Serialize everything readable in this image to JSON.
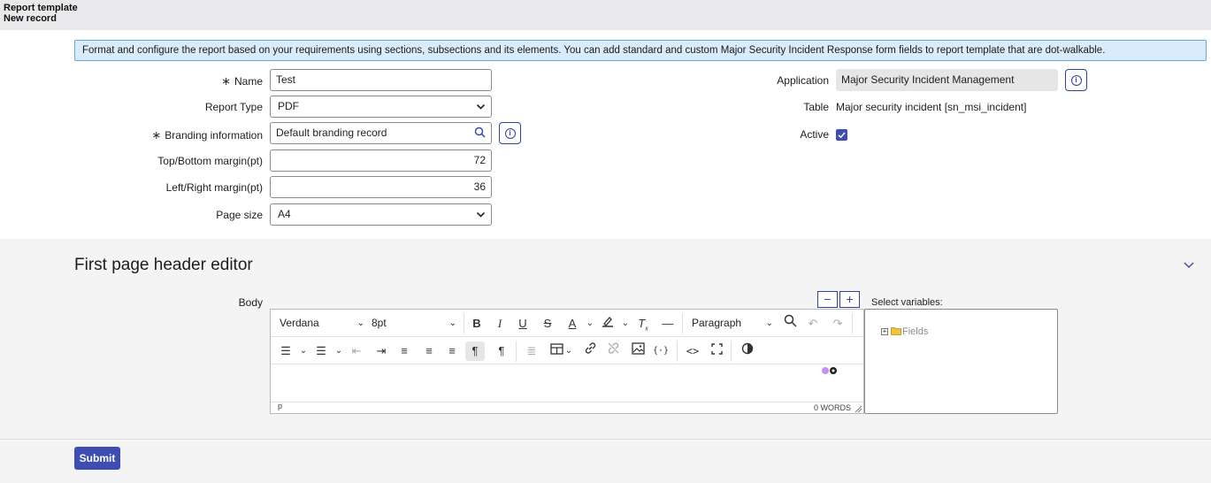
{
  "header": {
    "title": "Report template",
    "subtitle": "New record"
  },
  "banner": {
    "text": "Format and configure the report based on your requirements using sections, subsections and its elements. You can add standard and custom Major Security Incident Response form fields to report template that are dot-walkable."
  },
  "form": {
    "name_label": "Name",
    "name_value": "Test",
    "report_type_label": "Report Type",
    "report_type_value": "PDF",
    "branding_label": "Branding information",
    "branding_value": "Default branding record",
    "top_bottom_label": "Top/Bottom margin(pt)",
    "top_bottom_value": "72",
    "left_right_label": "Left/Right margin(pt)",
    "left_right_value": "36",
    "page_size_label": "Page size",
    "page_size_value": "A4",
    "application_label": "Application",
    "application_value": "Major Security Incident Management",
    "table_label": "Table",
    "table_value": "Major security incident [sn_msi_incident]",
    "active_label": "Active",
    "active_checked": true,
    "required_marker": "∗"
  },
  "section": {
    "title": "First page header editor",
    "body_label": "Body",
    "select_variables_label": "Select variables:",
    "tree_root": "Fields"
  },
  "editor": {
    "font_family": "Verdana",
    "font_size": "8pt",
    "block_format": "Paragraph",
    "word_count": "0 WORDS",
    "path": "p"
  },
  "actions": {
    "submit_label": "Submit"
  },
  "colors": {
    "accent": "#3f4cb1",
    "banner_bg": "#d9ecfb",
    "banner_border": "#6aa6de"
  }
}
